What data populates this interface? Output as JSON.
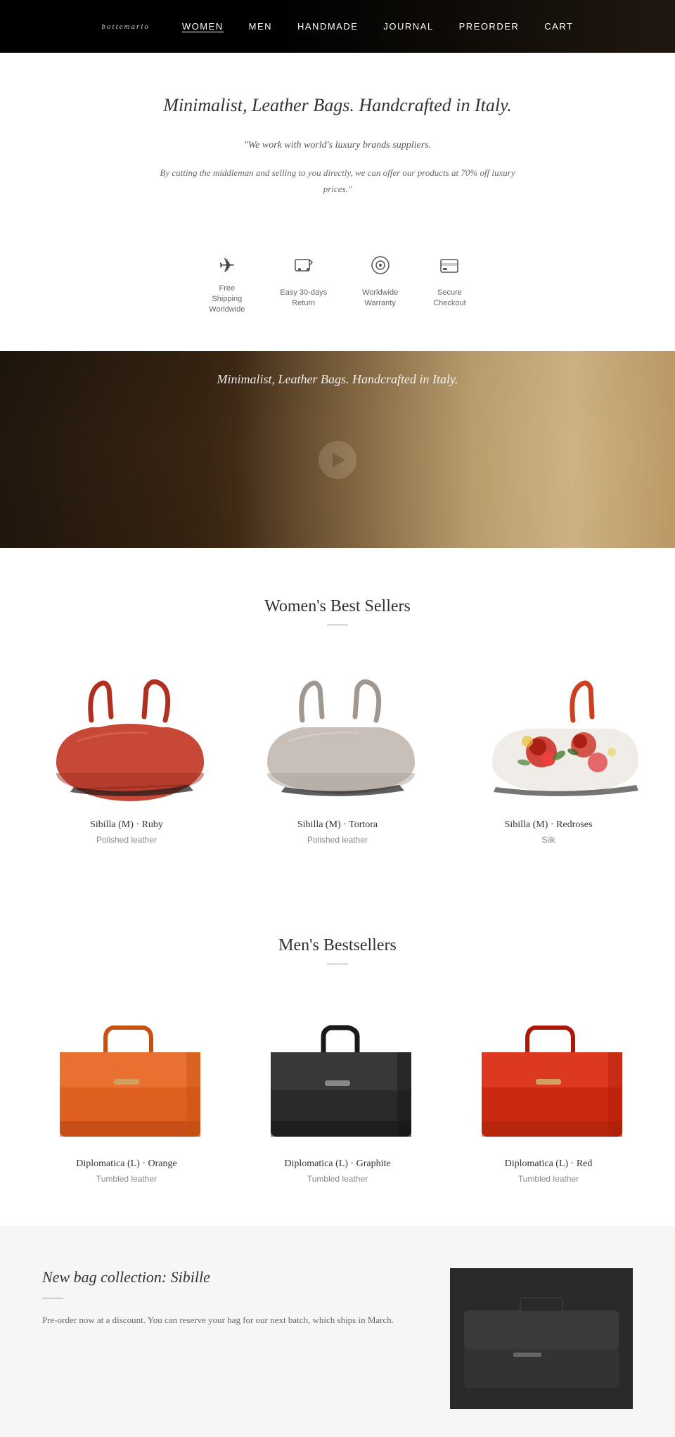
{
  "nav": {
    "logo": "bottemario",
    "links": [
      "WOMEN",
      "MEN",
      "HANDMADE",
      "JOURNAL",
      "PREORDER",
      "CART"
    ]
  },
  "intro": {
    "heading": "Minimalist, Leather Bags. Handcrafted in Italy.",
    "quote": "\"We work with world's luxury brands suppliers.",
    "description": "By cutting the middleman and selling to you directly, we can offer our products at 70% off luxury prices.\"",
    "icons": [
      {
        "symbol": "✈",
        "label": "Free\nShipping\nWorldwide"
      },
      {
        "symbol": "↩",
        "label": "Easy 30-days\nReturn"
      },
      {
        "symbol": "◎",
        "label": "Worldwide\nWarranty"
      },
      {
        "symbol": "⊡",
        "label": "Secure\nCheckout"
      }
    ]
  },
  "video": {
    "text": "Minimalist, Leather Bags. Handcrafted in Italy."
  },
  "womens": {
    "section_title": "Women's Best Sellers",
    "products": [
      {
        "name": "Sibilla (M) · Ruby",
        "material": "Polished leather",
        "color": "ruby"
      },
      {
        "name": "Sibilla (M) · Tortora",
        "material": "Polished leather",
        "color": "tortora"
      },
      {
        "name": "Sibilla (M) · Redroses",
        "material": "Silk",
        "color": "redroses"
      }
    ]
  },
  "mens": {
    "section_title": "Men's Bestsellers",
    "products": [
      {
        "name": "Diplomatica (L) · Orange",
        "material": "Tumbled leather",
        "color": "orange"
      },
      {
        "name": "Diplomatica (L) · Graphite",
        "material": "Tumbled leather",
        "color": "graphite"
      },
      {
        "name": "Diplomatica (L) · Red",
        "material": "Tumbled leather",
        "color": "red"
      }
    ]
  },
  "preorder": {
    "title": "New bag collection: Sibille",
    "description": "Pre-order now at a discount. You can reserve your bag for our next batch, which ships in March."
  }
}
